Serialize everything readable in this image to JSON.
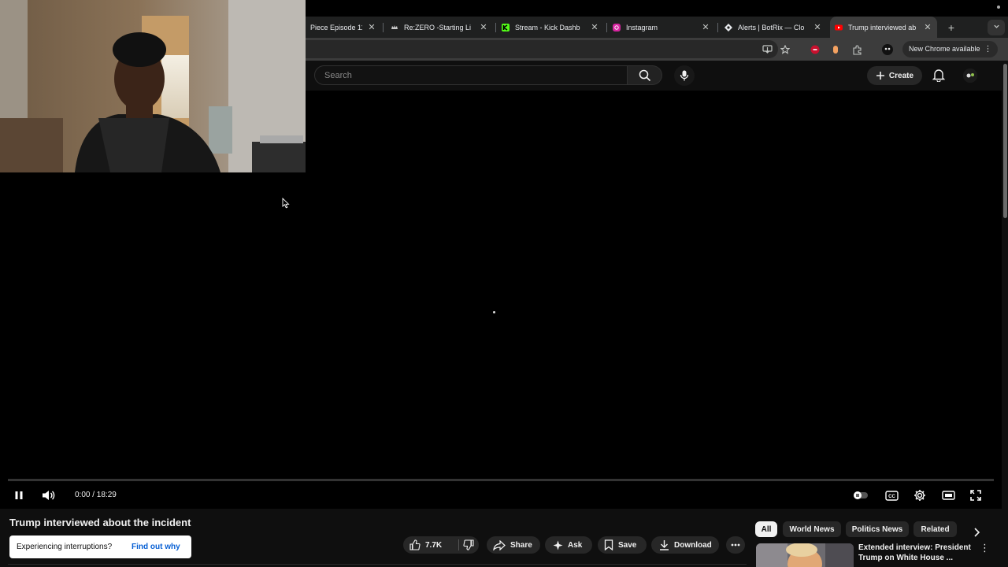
{
  "browser": {
    "tabs": [
      {
        "title": "Piece Episode 11",
        "icon": "generic-favicon",
        "close": "✕"
      },
      {
        "title": "Re:ZERO -Starting Li",
        "icon": "crown-favicon",
        "close": "✕"
      },
      {
        "title": "Stream - Kick Dashb",
        "icon": "kick-favicon",
        "close": "✕"
      },
      {
        "title": "Instagram",
        "icon": "instagram-favicon",
        "close": "✕"
      },
      {
        "title": "Alerts | BotRix — Clo",
        "icon": "botrix-favicon",
        "close": "✕"
      },
      {
        "title": "Trump interviewed ab",
        "icon": "youtube-favicon",
        "close": "✕"
      }
    ],
    "new_tab": "+",
    "update_button": "New Chrome available",
    "colors": {
      "kick": "#53fc18",
      "youtube": "#ff0000",
      "instagram": "#d6249f"
    }
  },
  "youtube": {
    "search_placeholder": "Search",
    "create_label": "Create",
    "player": {
      "current_time": "0:00",
      "duration": "18:29",
      "time_display": "0:00 / 18:29",
      "progress": 0
    },
    "video": {
      "title": "Trump interviewed about the incident",
      "likes": "7.7K",
      "actions": {
        "share": "Share",
        "ask": "Ask",
        "save": "Save",
        "download": "Download"
      }
    },
    "toast": {
      "message": "Experiencing interruptions?",
      "link": "Find out why"
    },
    "chips": [
      "All",
      "World News",
      "Politics News",
      "Related"
    ],
    "recommendation": {
      "title": "Extended interview: President Trump on White House ..."
    }
  }
}
